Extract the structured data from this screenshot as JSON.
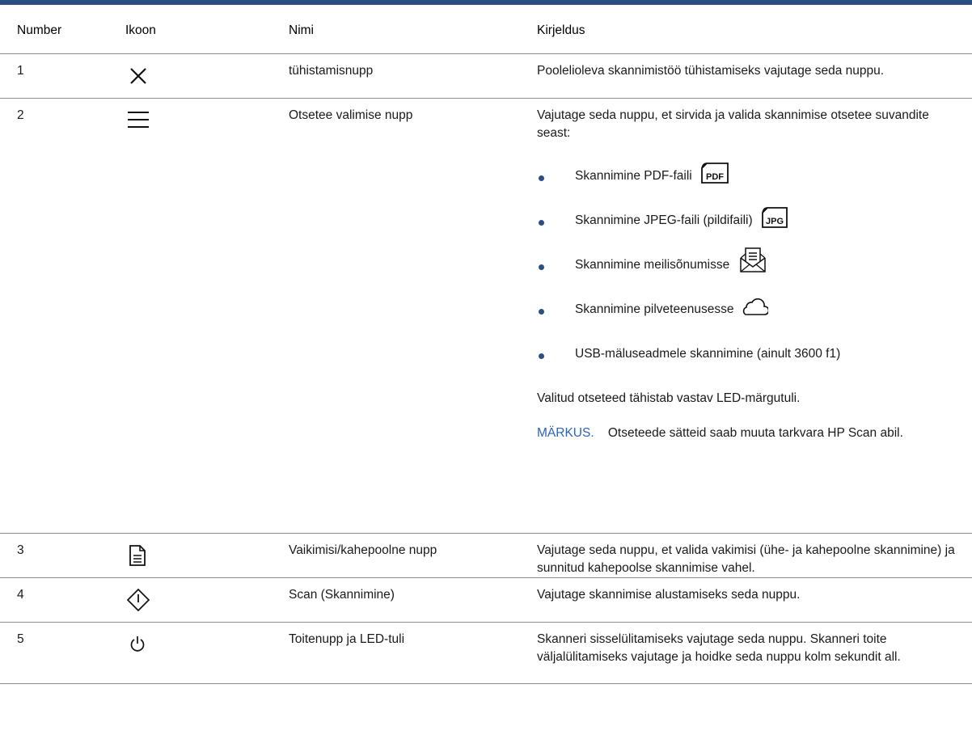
{
  "headers": {
    "number": "Number",
    "icon": "Ikoon",
    "name": "Nimi",
    "description": "Kirjeldus"
  },
  "rows": [
    {
      "number": "1",
      "icon": "close-icon",
      "name": "tühistamisnupp",
      "description": "Poolelioleva skannimistöö tühistamiseks vajutage seda nuppu."
    },
    {
      "number": "2",
      "icon": "menu-icon",
      "name": "Otsetee valimise nupp",
      "description": "Vajutage seda nuppu, et sirvida ja valida skannimise otsetee suvandite seast:",
      "bullets": [
        {
          "text": "Skannimine PDF-faili",
          "icon": "pdf-file-icon",
          "icon_label": "PDF"
        },
        {
          "text": "Skannimine JPEG-faili (pildifaili)",
          "icon": "jpg-file-icon",
          "icon_label": "JPG"
        },
        {
          "text": "Skannimine meilisõnumisse",
          "icon": "email-icon"
        },
        {
          "text": "Skannimine pilveteenusesse",
          "icon": "cloud-icon"
        },
        {
          "text": "USB-mäluseadmele skannimine (ainult 3600 f1)"
        }
      ],
      "after": "Valitud otseteed tähistab vastav LED-märgutuli.",
      "note_label": "MÄRKUS.",
      "note_text": "Otseteede sätteid saab muuta tarkvara HP Scan abil."
    },
    {
      "number": "3",
      "icon": "document-icon",
      "name": "Vaikimisi/kahepoolne nupp",
      "description": "Vajutage seda nuppu, et valida vakimisi (ühe- ja kahepoolne skannimine) ja sunnitud kahepoolse skannimise vahel."
    },
    {
      "number": "4",
      "icon": "scan-start-icon",
      "name": "Scan (Skannimine)",
      "description": "Vajutage skannimise alustamiseks seda nuppu."
    },
    {
      "number": "5",
      "icon": "power-icon",
      "name": "Toitenupp ja LED-tuli",
      "description": "Skanneri sisselülitamiseks vajutage seda nuppu. Skanneri toite väljalülitamiseks vajutage ja hoidke seda nuppu kolm sekundit all."
    }
  ],
  "colors": {
    "header_bar": "#2a4f80",
    "bullet": "#2a4f80",
    "note_label": "#2a63b8",
    "rule": "#8c8c8c"
  }
}
